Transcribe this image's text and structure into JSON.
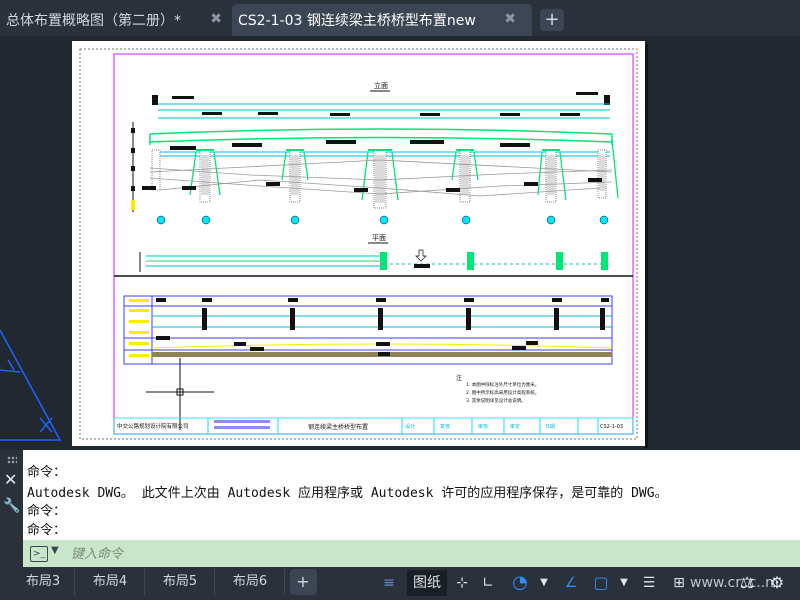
{
  "tabs": [
    {
      "label": "总体布置概略图（第二册）*",
      "active": false
    },
    {
      "label": "CS2-1-03 钢连续梁主桥桥型布置new",
      "active": true
    }
  ],
  "tab_close_glyph": "✖",
  "new_tab_glyph": "+",
  "drawing": {
    "elevation_title": "立面",
    "plan_title": "平面",
    "notes_title": "注",
    "notes": [
      "1. 本图中除标注外尺寸单位为厘米。",
      "2. 图中所示标高采用设计高程系统。",
      "3. 其余说明详见设计总说明。"
    ],
    "title_block": {
      "company": "中交公路规划设计院有限公司",
      "drawing_name": "钢连续梁主桥桥型布置",
      "fields": [
        "设计",
        "复核",
        "审核",
        "审定",
        "日期"
      ],
      "drawing_no": "CS2-1-03"
    }
  },
  "command_history": [
    "命令：",
    "Autodesk DWG。  此文件上次由 Autodesk 应用程序或 Autodesk 许可的应用程序保存，是可靠的 DWG。",
    "命令：",
    "命令："
  ],
  "command_input": {
    "placeholder": "键入命令"
  },
  "layout_tabs": [
    "布局3",
    "布局4",
    "布局5",
    "布局6"
  ],
  "add_layout_glyph": "+",
  "status": {
    "paper_label": "图纸"
  },
  "watermark": "www.cr..c..m"
}
